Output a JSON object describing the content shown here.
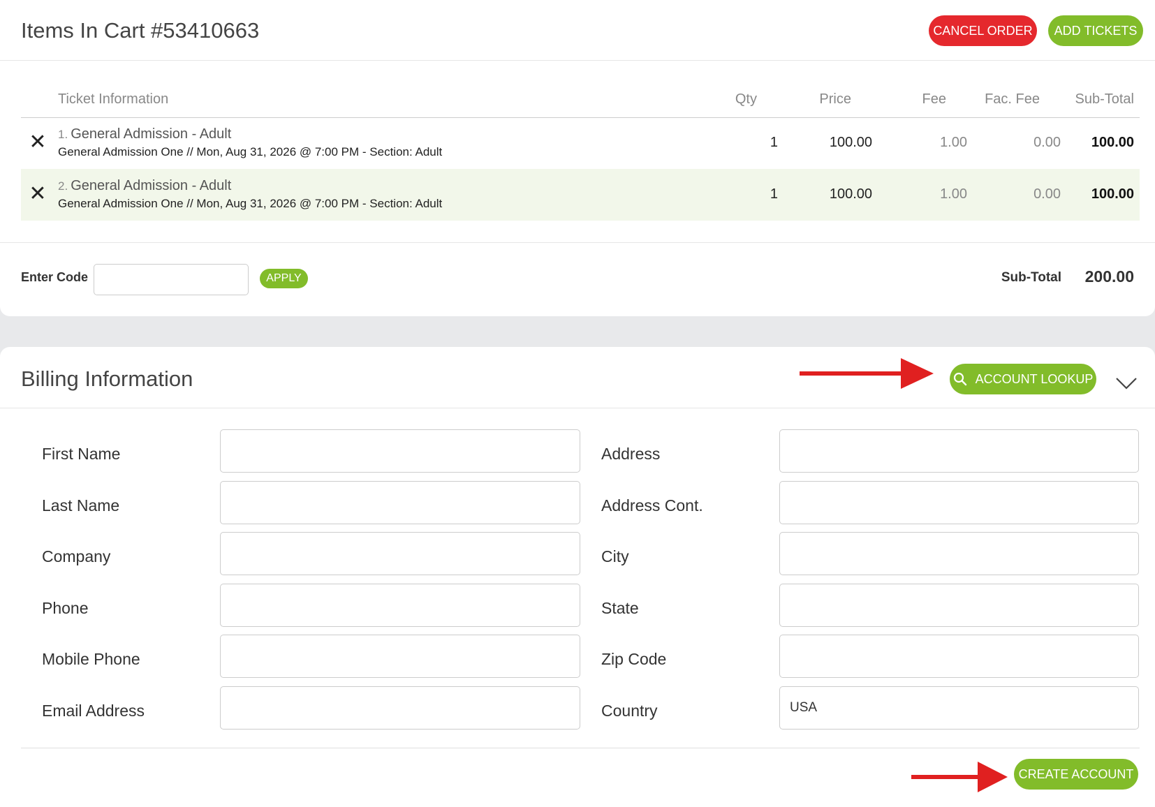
{
  "cart": {
    "title": "Items In Cart #53410663",
    "cancel_label": "CANCEL ORDER",
    "add_label": "ADD TICKETS",
    "columns": [
      "Ticket Information",
      "Qty",
      "Price",
      "Fee",
      "Fac. Fee",
      "Sub-Total"
    ],
    "items": [
      {
        "num": "1.",
        "title": "General Admission - Adult",
        "sub": "General Admission One // Mon, Aug 31, 2026 @ 7:00 PM - Section: Adult",
        "qty": "1",
        "price": "100.00",
        "fee": "1.00",
        "fac_fee": "0.00",
        "subtotal": "100.00"
      },
      {
        "num": "2.",
        "title": "General Admission - Adult",
        "sub": "General Admission One // Mon, Aug 31, 2026 @ 7:00 PM - Section: Adult",
        "qty": "1",
        "price": "100.00",
        "fee": "1.00",
        "fac_fee": "0.00",
        "subtotal": "100.00"
      }
    ],
    "code_label": "Enter Code",
    "code_value": "",
    "apply_label": "APPLY",
    "subtotal_label": "Sub-Total",
    "subtotal_value": "200.00"
  },
  "billing": {
    "title": "Billing Information",
    "lookup_label": "ACCOUNT LOOKUP",
    "left_fields": [
      {
        "label": "First Name",
        "value": ""
      },
      {
        "label": "Last Name",
        "value": ""
      },
      {
        "label": "Company",
        "value": ""
      },
      {
        "label": "Phone",
        "value": ""
      },
      {
        "label": "Mobile Phone",
        "value": ""
      },
      {
        "label": "Email Address",
        "value": ""
      }
    ],
    "right_fields": [
      {
        "label": "Address",
        "value": ""
      },
      {
        "label": "Address Cont.",
        "value": ""
      },
      {
        "label": "City",
        "value": ""
      },
      {
        "label": "State",
        "value": ""
      },
      {
        "label": "Zip Code",
        "value": ""
      },
      {
        "label": "Country",
        "value": "USA"
      }
    ],
    "create_label": "CREATE ACCOUNT"
  },
  "colors": {
    "green": "#82bc2a",
    "red": "#e5282d",
    "arrow": "#e02020"
  },
  "icons": [
    "close-icon",
    "search-icon",
    "chevron-down-icon",
    "arrow-right-icon"
  ]
}
